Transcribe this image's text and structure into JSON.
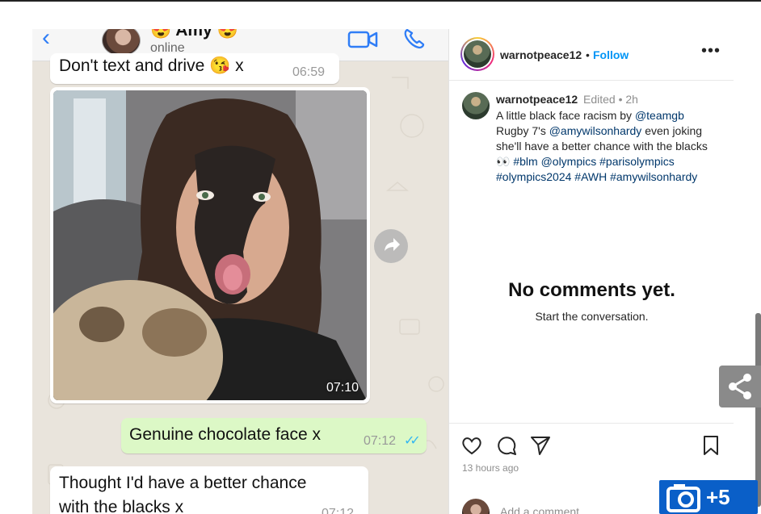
{
  "whatsapp": {
    "contact_name": "😍 Amy 😍",
    "contact_status": "online",
    "messages": [
      {
        "text": "Don't text and drive 😘 x",
        "time": "06:59",
        "direction": "in"
      },
      {
        "photo_time": "07:10",
        "direction": "in"
      },
      {
        "text": "Genuine chocolate face x",
        "time": "07:12",
        "direction": "out",
        "read_ticks": "✓✓"
      },
      {
        "text_line1": "Thought I'd have a better chance",
        "text_line2": "with the blacks x",
        "time": "07:12",
        "direction": "in"
      }
    ]
  },
  "instagram": {
    "username": "warnotpeace12",
    "follow_label": "Follow",
    "caption_meta": "Edited • 2h",
    "caption_lines": [
      "A little black face racism by ",
      "@teamgb",
      "Rugby 7's ",
      "@amywilsonhardy",
      " even joking",
      "she'll have a better chance with the blacks",
      "👀 ",
      "#blm",
      "@olympics",
      "#parisolympics",
      "#olympics2024",
      "#AWH",
      "#amywilsonhardy"
    ],
    "empty_title": "No comments yet.",
    "empty_subtitle": "Start the conversation.",
    "time_ago": "13 hours ago",
    "comment_placeholder": "Add a comment..."
  },
  "overlay": {
    "gallery_count": "+5"
  },
  "colors": {
    "whatsapp_out_bubble": "#dcf8c6",
    "instagram_link": "#0095f6",
    "gallery_button": "#0a5fc8"
  }
}
